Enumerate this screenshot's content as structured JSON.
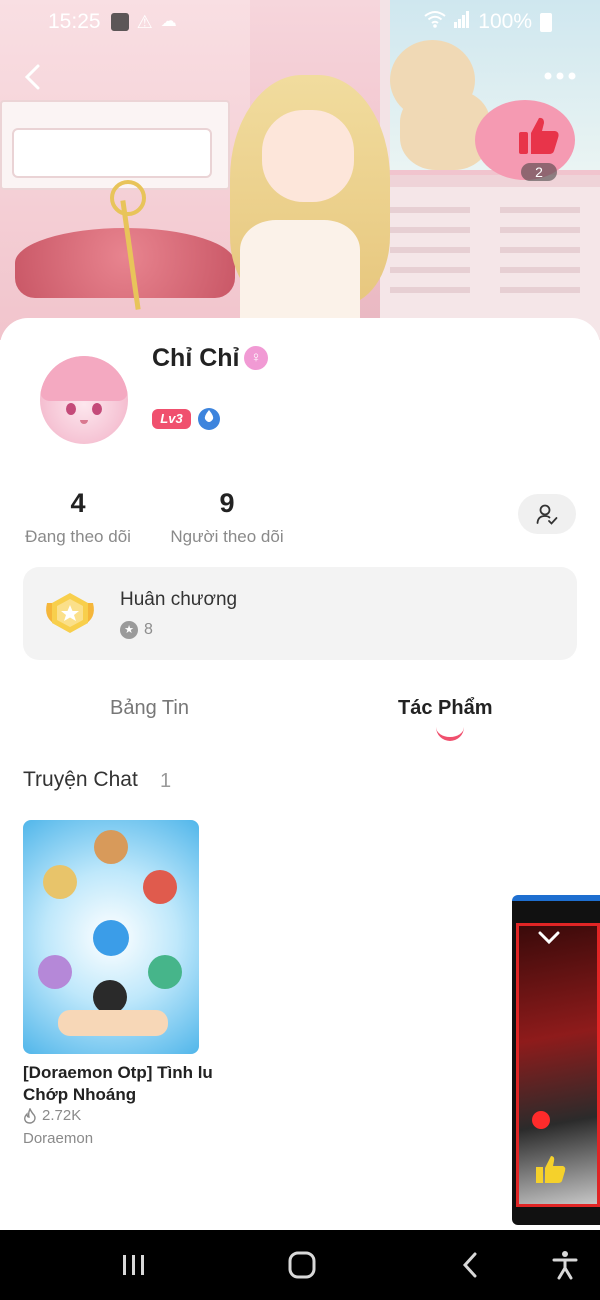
{
  "status_bar": {
    "time": "15:25",
    "battery": "100%"
  },
  "header": {
    "like_count": "2"
  },
  "profile": {
    "name": "Chỉ Chỉ",
    "gender_symbol": "♀",
    "level_badge": "Lv3",
    "following_count": "4",
    "following_label": "Đang theo dõi",
    "followers_count": "9",
    "followers_label": "Người theo dõi"
  },
  "medals": {
    "title": "Huân chương",
    "count": "8"
  },
  "tabs": [
    {
      "label": "Bảng Tin",
      "active": false
    },
    {
      "label": "Tác Phẩm",
      "active": true
    }
  ],
  "section": {
    "title": "Truyện Chat",
    "count": "1"
  },
  "stories": [
    {
      "title": "[Doraemon Otp] Tình lu Chớp Nhoáng",
      "views": "2.72K",
      "tag": "Doraemon"
    }
  ],
  "colors": {
    "accent": "#f0506e",
    "badge_blue": "#3d84dd",
    "gender_pink": "#f19ad4",
    "like_red": "#e8344a"
  },
  "icons": {
    "back": "chevron-left-icon",
    "more": "more-dots-icon",
    "like": "thumbs-up-icon",
    "follow": "person-check-icon",
    "medal": "medal-icon",
    "views": "fire-icon"
  }
}
